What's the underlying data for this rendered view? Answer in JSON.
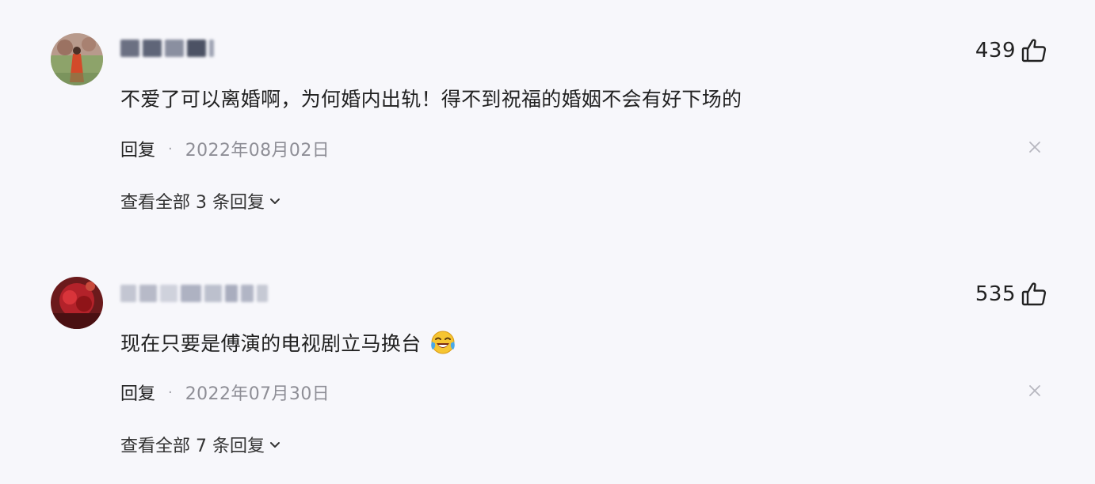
{
  "comments": [
    {
      "text": "不爱了可以离婚啊，为何婚内出轨！得不到祝福的婚姻不会有好下场的",
      "likes": "439",
      "reply_label": "回复",
      "separator": "·",
      "date": "2022年08月02日",
      "view_replies": "查看全部 3 条回复",
      "has_emoji": false
    },
    {
      "text": "现在只要是傅演的电视剧立马换台",
      "likes": "535",
      "reply_label": "回复",
      "separator": "·",
      "date": "2022年07月30日",
      "view_replies": "查看全部 7 条回复",
      "has_emoji": true,
      "emoji_name": "laughing-crying-emoji"
    }
  ],
  "icons": {
    "like": "thumbs-up-icon",
    "close": "close-icon",
    "expand": "chevron-down-icon"
  },
  "colors": {
    "background": "#f7f7fb",
    "text": "#222222",
    "date": "#8e8e96"
  }
}
